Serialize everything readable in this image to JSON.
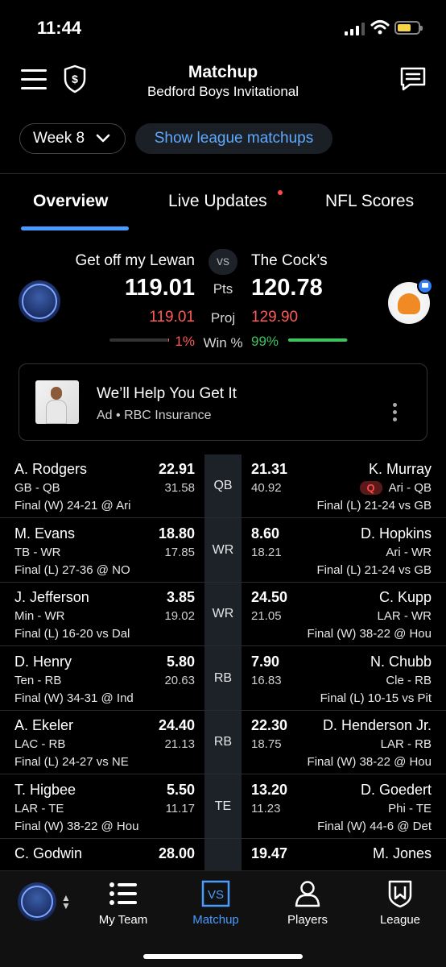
{
  "status": {
    "time": "11:44"
  },
  "header": {
    "title": "Matchup",
    "subtitle": "Bedford Boys Invitational"
  },
  "week": {
    "label": "Week 8"
  },
  "league_button": {
    "label": "Show league matchups"
  },
  "tabs": [
    {
      "label": "Overview",
      "active": true
    },
    {
      "label": "Live Updates",
      "has_dot": true
    },
    {
      "label": "NFL Scores"
    }
  ],
  "summary": {
    "left": {
      "name": "Get off my Lewan",
      "points": "119.01",
      "projected": "119.01",
      "win_pct": "1%",
      "win_fraction": 0.01
    },
    "right": {
      "name": "The Cock’s",
      "points": "120.78",
      "projected": "129.90",
      "win_pct": "99%",
      "win_fraction": 0.99
    },
    "vs": "vs",
    "pts_label": "Pts",
    "proj_label": "Proj",
    "win_label": "Win %",
    "colors": {
      "win": "#3ec45e",
      "loss": "#ff5a5a",
      "accent": "#4a9bff"
    }
  },
  "ad": {
    "title": "We’ll Help You Get It",
    "sponsor": "Ad • RBC Insurance"
  },
  "players": [
    {
      "pos": "QB",
      "left": {
        "name": "A. Rodgers",
        "score": "22.91",
        "team": "GB - QB",
        "proj": "31.58",
        "game": "Final (W) 24-21 @ Ari"
      },
      "right": {
        "name": "K. Murray",
        "score": "21.31",
        "team": "Ari - QB",
        "proj": "40.92",
        "game": "Final (L) 21-24 vs GB",
        "injury": "Q"
      }
    },
    {
      "pos": "WR",
      "left": {
        "name": "M. Evans",
        "score": "18.80",
        "team": "TB - WR",
        "proj": "17.85",
        "game": "Final (L) 27-36 @ NO"
      },
      "right": {
        "name": "D. Hopkins",
        "score": "8.60",
        "team": "Ari - WR",
        "proj": "18.21",
        "game": "Final (L) 21-24 vs GB"
      }
    },
    {
      "pos": "WR",
      "left": {
        "name": "J. Jefferson",
        "score": "3.85",
        "team": "Min - WR",
        "proj": "19.02",
        "game": "Final (L) 16-20 vs Dal"
      },
      "right": {
        "name": "C. Kupp",
        "score": "24.50",
        "team": "LAR - WR",
        "proj": "21.05",
        "game": "Final (W) 38-22 @ Hou"
      }
    },
    {
      "pos": "RB",
      "left": {
        "name": "D. Henry",
        "score": "5.80",
        "team": "Ten - RB",
        "proj": "20.63",
        "game": "Final (W) 34-31 @ Ind"
      },
      "right": {
        "name": "N. Chubb",
        "score": "7.90",
        "team": "Cle - RB",
        "proj": "16.83",
        "game": "Final (L) 10-15 vs Pit"
      }
    },
    {
      "pos": "RB",
      "left": {
        "name": "A. Ekeler",
        "score": "24.40",
        "team": "LAC - RB",
        "proj": "21.13",
        "game": "Final (L) 24-27 vs NE"
      },
      "right": {
        "name": "D. Henderson Jr.",
        "score": "22.30",
        "team": "LAR - RB",
        "proj": "18.75",
        "game": "Final (W) 38-22 @ Hou"
      }
    },
    {
      "pos": "TE",
      "left": {
        "name": "T. Higbee",
        "score": "5.50",
        "team": "LAR - TE",
        "proj": "11.17",
        "game": "Final (W) 38-22 @ Hou"
      },
      "right": {
        "name": "D. Goedert",
        "score": "13.20",
        "team": "Phi - TE",
        "proj": "11.23",
        "game": "Final (W) 44-6 @ Det"
      }
    },
    {
      "pos": "",
      "left": {
        "name": "C. Godwin",
        "score": "28.00"
      },
      "right": {
        "name": "M. Jones",
        "score": "19.47"
      }
    }
  ],
  "bottom_nav": [
    {
      "label": "My Team",
      "icon": "list-icon"
    },
    {
      "label": "Matchup",
      "icon": "vs-icon",
      "active": true
    },
    {
      "label": "Players",
      "icon": "person-icon"
    },
    {
      "label": "League",
      "icon": "shield-crest-icon"
    }
  ]
}
